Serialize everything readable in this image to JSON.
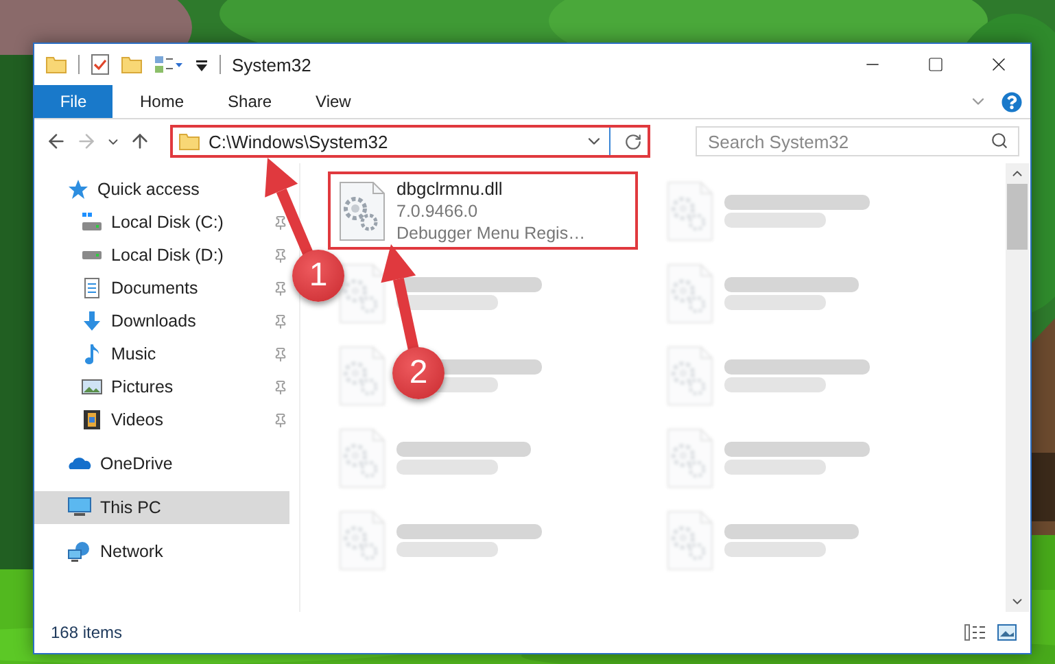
{
  "window": {
    "title": "System32"
  },
  "ribbon_tabs": [
    {
      "label": "File",
      "kind": "file",
      "selected": false
    },
    {
      "label": "Home",
      "kind": "tab",
      "selected": false
    },
    {
      "label": "Share",
      "kind": "tab",
      "selected": false
    },
    {
      "label": "View",
      "kind": "tab",
      "selected": false
    }
  ],
  "address_bar": {
    "path": "C:\\Windows\\System32",
    "highlighted": true
  },
  "search": {
    "placeholder": "Search System32"
  },
  "navigation": [
    {
      "label": "Quick access",
      "kind": "star",
      "selected": false,
      "children": [
        {
          "label": "Local Disk (C:)",
          "kind": "sysdrive",
          "pinned": true,
          "selected": false
        },
        {
          "label": "Local Disk (D:)",
          "kind": "drive",
          "pinned": true,
          "selected": false
        },
        {
          "label": "Documents",
          "kind": "documents",
          "pinned": true,
          "selected": false
        },
        {
          "label": "Downloads",
          "kind": "downloads",
          "pinned": true,
          "selected": false
        },
        {
          "label": "Music",
          "kind": "music",
          "pinned": true,
          "selected": false
        },
        {
          "label": "Pictures",
          "kind": "pictures",
          "pinned": true,
          "selected": false
        },
        {
          "label": "Videos",
          "kind": "videos",
          "pinned": true,
          "selected": false
        }
      ]
    },
    {
      "label": "OneDrive",
      "kind": "cloud",
      "selected": false
    },
    {
      "label": "This PC",
      "kind": "computer",
      "selected": true
    },
    {
      "label": "Network",
      "kind": "network",
      "selected": false
    }
  ],
  "files": [
    {
      "name": "dbgclrmnu.dll",
      "details": [
        "7.0.9466.0",
        "Debugger Menu Regis…"
      ],
      "highlighted": true
    },
    {
      "blurred": true
    },
    {
      "blurred": true
    },
    {
      "blurred": true
    },
    {
      "blurred": true
    },
    {
      "blurred": true
    },
    {
      "blurred": true
    },
    {
      "blurred": true
    },
    {
      "blurred": true
    },
    {
      "blurred": true
    }
  ],
  "status_bar": {
    "item_count": "168 items"
  },
  "annotations": [
    {
      "label": "1"
    },
    {
      "label": "2"
    }
  ]
}
